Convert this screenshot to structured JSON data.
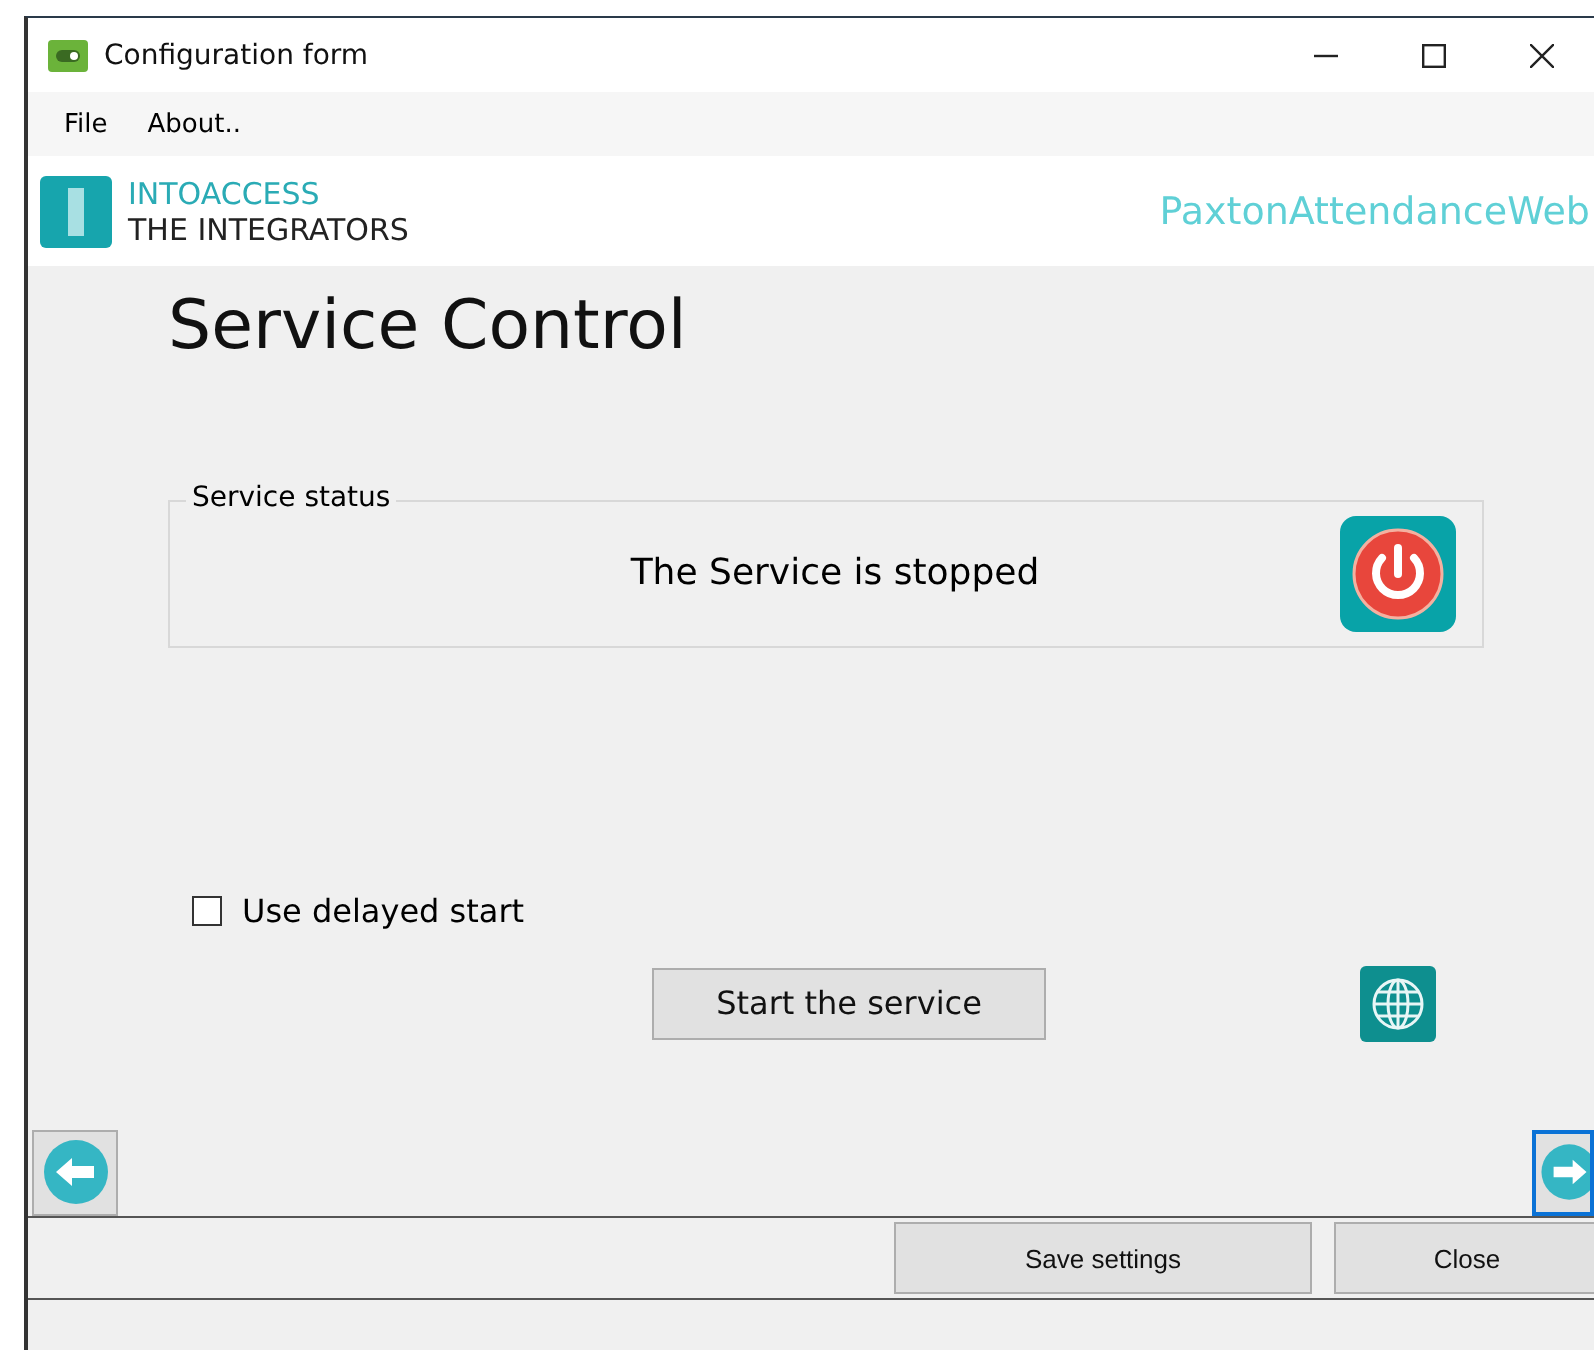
{
  "window": {
    "title": "Configuration form"
  },
  "menu": [
    "File",
    "About.."
  ],
  "header": {
    "brand_top": "INTOACCESS",
    "brand_bottom": "THE INTEGRATORS",
    "product": "PaxtonAttendanceWeb"
  },
  "page_title": "Service Control",
  "status_group": {
    "legend": "Service status",
    "message": "The Service is stopped",
    "running": false
  },
  "delayed_start": {
    "label": "Use delayed start",
    "checked": false
  },
  "start_button": "Start the service",
  "footer_buttons": [
    "Save settings",
    "Close"
  ]
}
